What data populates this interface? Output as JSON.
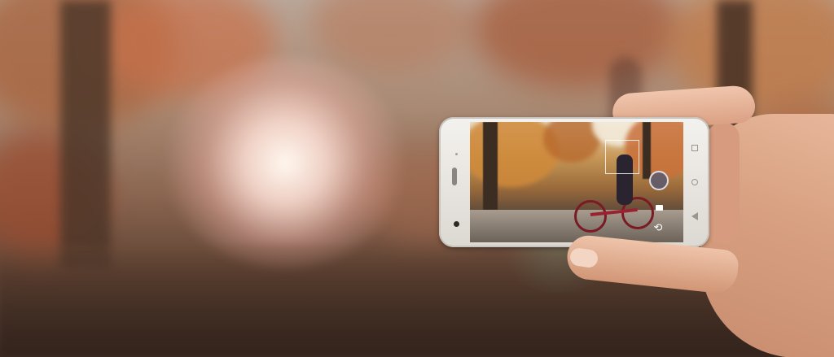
{
  "scene": {
    "description_colors": {
      "sky_glow": "#fff8f0",
      "foliage": "#c9714a",
      "phone_body": "#f4f2ee",
      "skin": "#e0ab8d"
    }
  },
  "phone": {
    "camera_app": {
      "icons": {
        "shutter": "shutter-button",
        "switch_camera": "switch-camera-icon",
        "video": "video-mode-icon"
      },
      "switch_camera_glyph": "⟲"
    },
    "nav_icons": [
      "recent-apps-icon",
      "home-icon",
      "back-icon"
    ]
  }
}
